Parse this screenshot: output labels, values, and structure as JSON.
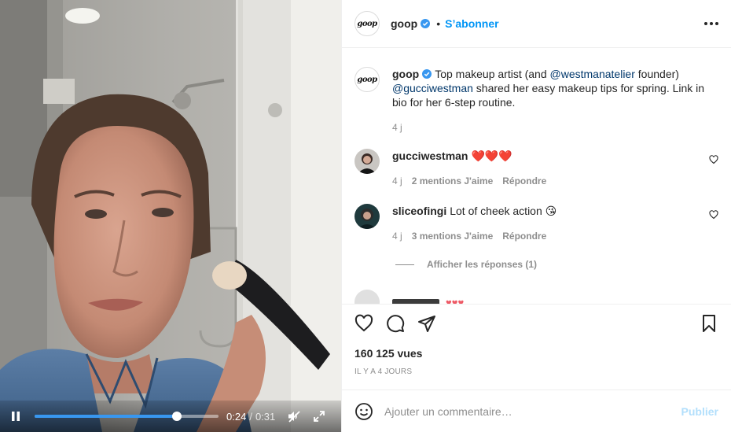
{
  "post": {
    "username": "goop",
    "avatar_text": "goop",
    "follow_label": "S’abonner",
    "dot": "•",
    "more_icon": "more-horizontal-icon"
  },
  "caption": {
    "username": "goop",
    "text_1": "Top makeup artist (and ",
    "mention_1": "@westmanatelier",
    "text_2": " founder) ",
    "mention_2": "@gucciwestman",
    "text_3": " shared her easy makeup tips for spring. Link in bio for her 6-step routine.",
    "time": "4 j"
  },
  "comments": [
    {
      "username": "gucciwestman",
      "text": "❤️❤️❤️",
      "time": "4 j",
      "likes": "2 mentions J'aime",
      "reply": "Répondre"
    },
    {
      "username": "sliceofingi",
      "text": "Lot of cheek action 😘",
      "time": "4 j",
      "likes": "3 mentions J'aime",
      "reply": "Répondre"
    }
  ],
  "show_replies": "Afficher les réponses (1)",
  "stats": {
    "views": "160 125 vues",
    "posted": "IL Y A 4 JOURS"
  },
  "add_comment": {
    "placeholder": "Ajouter un commentaire…",
    "publish": "Publier"
  },
  "video": {
    "current": "0:24",
    "duration": "0:31",
    "separator": "/",
    "progress": 0.7742,
    "icons": [
      "pause-icon",
      "mute-icon",
      "fullscreen-icon"
    ]
  },
  "colors": {
    "accent": "#0095f6",
    "progress_fill": "#3897f0",
    "publish_disabled": "#b2dffc",
    "heart_red": "#ed4956"
  }
}
